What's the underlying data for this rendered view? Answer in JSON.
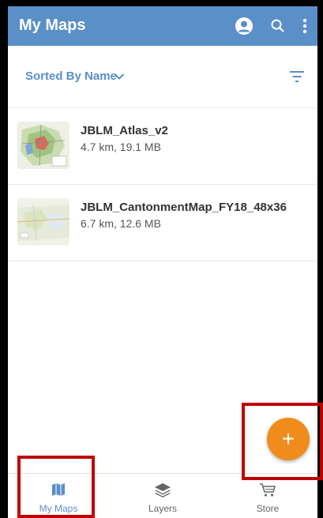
{
  "appbar": {
    "title": "My Maps",
    "bg_color": "#5b8fc8",
    "icons": [
      "account-circle-icon",
      "search-icon",
      "more-vert-icon"
    ]
  },
  "sort": {
    "label": "Sorted By Name",
    "icons": [
      "chevron-down-icon",
      "filter-icon"
    ]
  },
  "maps": [
    {
      "name": "JBLM_Atlas_v2",
      "meta": "4.7 km, 19.1 MB"
    },
    {
      "name": "JBLM_CantonmentMap_FY18_48x36",
      "meta": "6.7 km, 12.6 MB"
    }
  ],
  "fab": {
    "label": "+",
    "color": "#f08c1c"
  },
  "bottom_nav": {
    "items": [
      {
        "label": "My Maps",
        "icon": "map-icon",
        "active": true
      },
      {
        "label": "Layers",
        "icon": "layers-icon",
        "active": false
      },
      {
        "label": "Store",
        "icon": "cart-icon",
        "active": false
      }
    ],
    "active_color": "#5b8fc8",
    "inactive_color": "#666666"
  },
  "highlight_color": "#c00000"
}
